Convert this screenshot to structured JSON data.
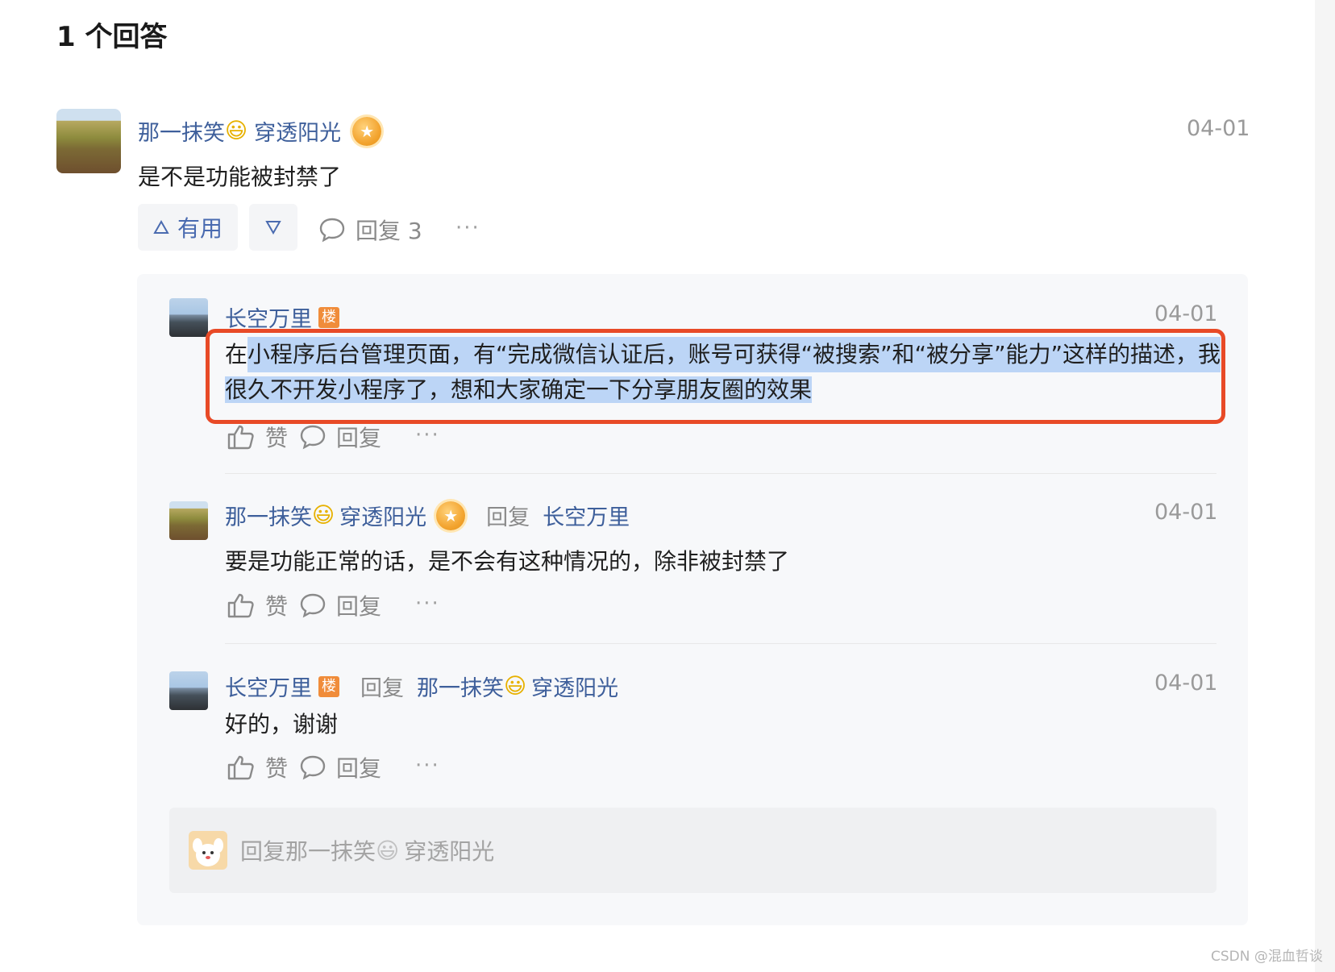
{
  "heading": "1 个回答",
  "answer": {
    "author": "那一抹笑",
    "author_emoji": "😃",
    "author_suffix": "穿透阳光",
    "medal": "★",
    "date": "04-01",
    "content": "是不是功能被封禁了",
    "useful_label": "有用",
    "reply_label": "回复 3",
    "more_label": "···"
  },
  "comments": [
    {
      "author": "长空万里",
      "badge": "楼",
      "date": "04-01",
      "content_prefix": "在",
      "content_selected_line1": "小程序后台管理页面，有“完成微信认证后，账号可获得“被搜索”和“被分享”能力”这样的描述，我",
      "content_selected_line2": "很久不开发小程序了，想和大家确定一下分享朋友圈的效果",
      "like_label": "赞",
      "reply_label": "回复",
      "more_label": "···"
    },
    {
      "author": "那一抹笑",
      "author_emoji": "😃",
      "author_suffix": "穿透阳光",
      "medal": "★",
      "reply_word": "回复",
      "reply_to": "长空万里",
      "date": "04-01",
      "content": "要是功能正常的话，是不会有这种情况的，除非被封禁了",
      "like_label": "赞",
      "reply_label": "回复",
      "more_label": "···"
    },
    {
      "author": "长空万里",
      "badge": "楼",
      "reply_word": "回复",
      "reply_to": "那一抹笑",
      "reply_to_emoji": "😃",
      "reply_to_suffix": "穿透阳光",
      "date": "04-01",
      "content": "好的，谢谢",
      "like_label": "赞",
      "reply_label": "回复",
      "more_label": "···"
    }
  ],
  "reply_box": {
    "placeholder_prefix": "回复那一抹笑",
    "placeholder_emoji": "😃",
    "placeholder_suffix": "穿透阳光"
  },
  "watermark": "CSDN @混血哲谈",
  "colors": {
    "link_blue": "#3e5f9b",
    "highlight": "#bcd5f6",
    "annotation_red": "#e84a27",
    "badge_orange": "#f08c3a"
  },
  "icons": [
    "triangle-up-icon",
    "triangle-down-icon",
    "speech-bubble-icon",
    "thumbs-up-icon",
    "more-dots-icon",
    "medal-icon"
  ]
}
